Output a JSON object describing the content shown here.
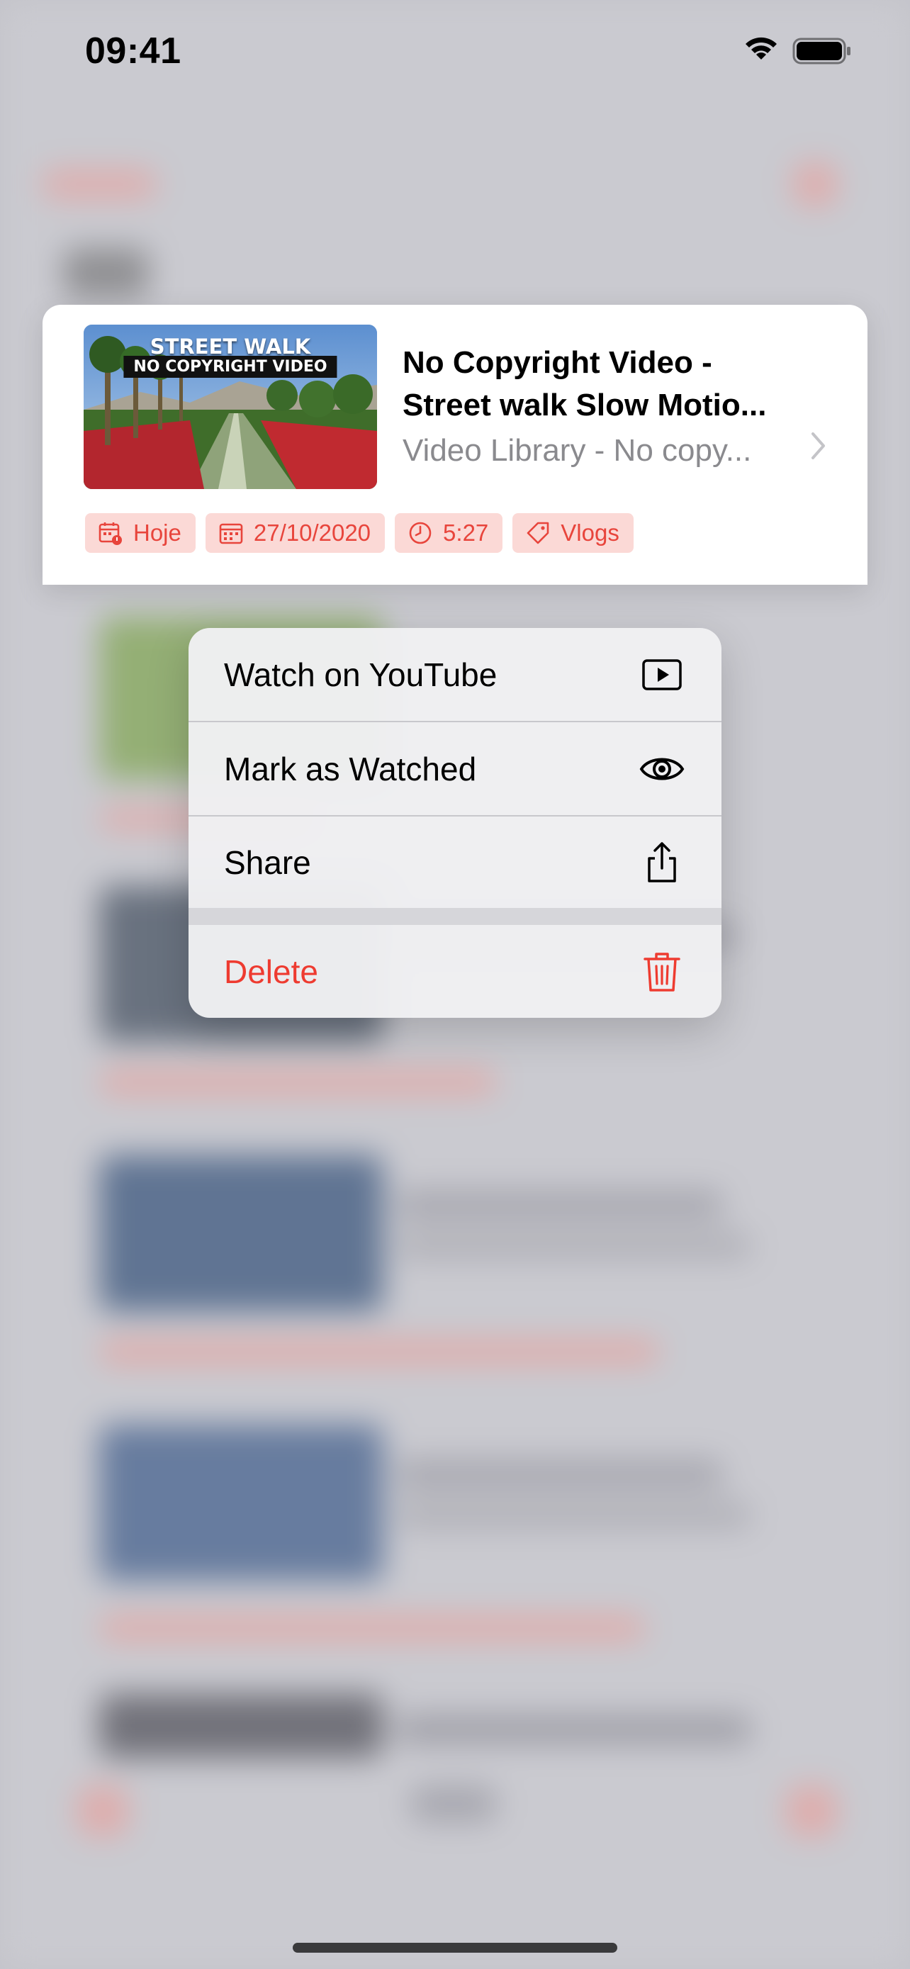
{
  "status_bar": {
    "time": "09:41"
  },
  "preview_card": {
    "thumbnail": {
      "line1": "STREET WALK",
      "line2": "NO COPYRIGHT VIDEO"
    },
    "title_line1": "No Copyright Video -",
    "title_line2": "Street walk Slow Motio...",
    "subtitle": "Video Library - No copy...",
    "tags": [
      {
        "icon": "calendar-badge-icon",
        "label": "Hoje"
      },
      {
        "icon": "calendar-icon",
        "label": "27/10/2020"
      },
      {
        "icon": "clock-icon",
        "label": "5:27"
      },
      {
        "icon": "tag-icon",
        "label": "Vlogs"
      }
    ]
  },
  "context_menu": {
    "items": [
      {
        "label": "Watch on YouTube",
        "icon": "play-rectangle-icon"
      },
      {
        "label": "Mark as Watched",
        "icon": "eye-icon"
      },
      {
        "label": "Share",
        "icon": "share-icon"
      },
      {
        "label": "Delete",
        "icon": "trash-icon",
        "destructive": true
      }
    ]
  },
  "colors": {
    "accent_red": "#e8453c",
    "tag_background": "#fbd9d6",
    "destructive": "#ee3b30",
    "menu_background": "#f0f0f2"
  }
}
